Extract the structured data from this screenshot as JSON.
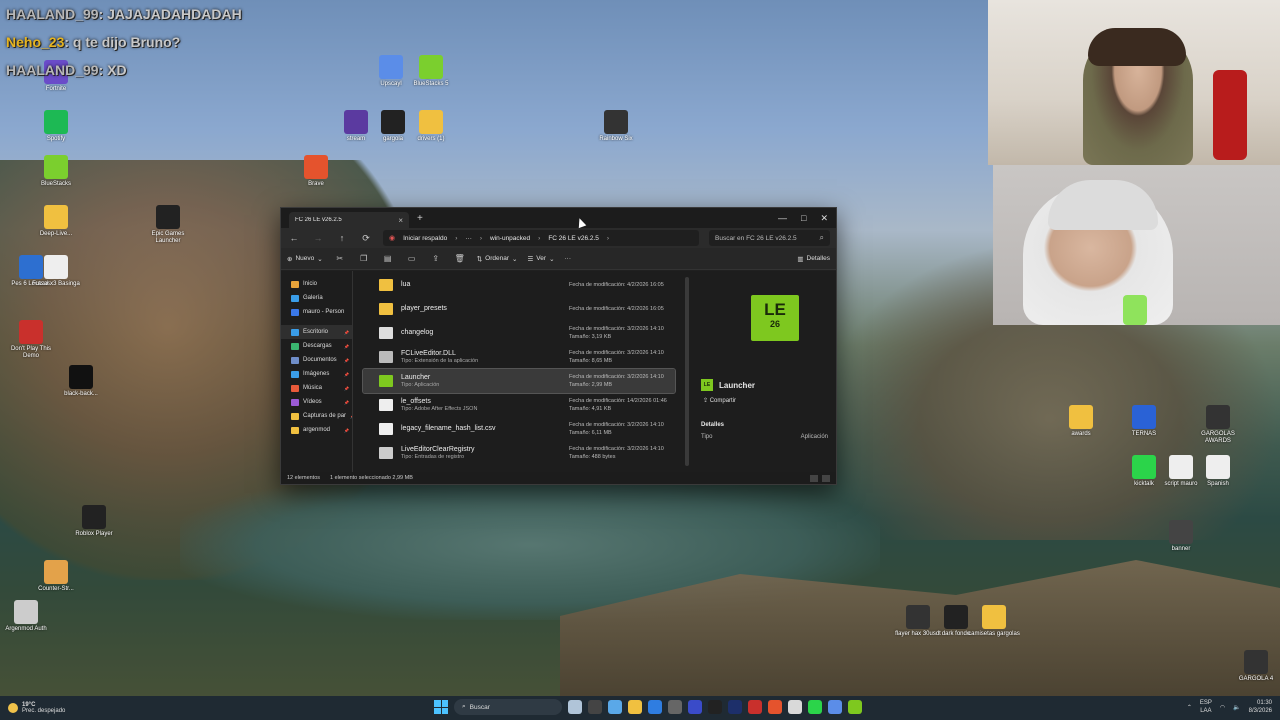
{
  "chat": [
    {
      "user": "HAALAND_99",
      "text": "JAJAJADAHDADAH"
    },
    {
      "user": "Neho_23",
      "text": "q te dijo Bruno?"
    },
    {
      "user": "HAALAND_99",
      "text": "XD"
    }
  ],
  "desktop_icons": [
    {
      "label": "Fortnite",
      "color": "#6a4cc9"
    },
    {
      "label": "Spotify",
      "color": "#1db954"
    },
    {
      "label": "BlueStacks",
      "color": "#7bcf2e"
    },
    {
      "label": "Deep-Live...",
      "color": "#f0c040"
    },
    {
      "label": "Pes 6 Locazos",
      "color": "#2d6fd0"
    },
    {
      "label": "Futsal x3 Basinga",
      "color": "#eeeeee"
    },
    {
      "label": "Don't Play This Demo",
      "color": "#c9302c"
    },
    {
      "label": "black-back...",
      "color": "#111111"
    },
    {
      "label": "Counter-Str...",
      "color": "#e3a24a"
    },
    {
      "label": "Roblox Player",
      "color": "#222222"
    },
    {
      "label": "Argenmod Auth",
      "color": "#cccccc"
    },
    {
      "label": "Epic Games Launcher",
      "color": "#222222"
    },
    {
      "label": "Upscayl",
      "color": "#5b8de8"
    },
    {
      "label": "BlueStacks 5",
      "color": "#7bcf2e"
    },
    {
      "label": "Brave",
      "color": "#e5532d"
    },
    {
      "label": "stream",
      "color": "#5b3aa0"
    },
    {
      "label": "gargola",
      "color": "#222222"
    },
    {
      "label": "drivers (1)",
      "color": "#f0c040"
    },
    {
      "label": "Rainbow Six",
      "color": "#333333"
    },
    {
      "label": "script mauro",
      "color": "#eeeeee"
    },
    {
      "label": "kicktalk",
      "color": "#2bd44a"
    },
    {
      "label": "Spanish",
      "color": "#eeeeee"
    },
    {
      "label": "awards",
      "color": "#f0c040"
    },
    {
      "label": "TERNAS",
      "color": "#2a62d6"
    },
    {
      "label": "GARGOLAS AWARDS",
      "color": "#333333"
    },
    {
      "label": "banner",
      "color": "#444444"
    },
    {
      "label": "flayer hax 30usdt",
      "color": "#333333"
    },
    {
      "label": "dark fondo",
      "color": "#222222"
    },
    {
      "label": "camisetas gargolas",
      "color": "#f0c040"
    },
    {
      "label": "GARGOLA 4",
      "color": "#333333"
    }
  ],
  "explorer": {
    "tab_title": "FC 26 LE v26.2.5",
    "breadcrumbs": [
      "Iniciar respaldo",
      "···",
      "win-unpacked",
      "FC 26 LE v26.2.5"
    ],
    "search_placeholder": "Buscar en FC 26 LE v26.2.5",
    "toolbar": {
      "new": "Nuevo",
      "sort": "Ordenar",
      "view": "Ver",
      "more": "···",
      "details": "Detalles"
    },
    "nav": {
      "top": [
        {
          "label": "Inicio",
          "color": "#e8a33a"
        },
        {
          "label": "Galería",
          "color": "#3a9de8"
        },
        {
          "label": "mauro - Person",
          "color": "#3a78e8"
        }
      ],
      "pinned": [
        {
          "label": "Escritorio",
          "color": "#3a9de8"
        },
        {
          "label": "Descargas",
          "color": "#3ab56f"
        },
        {
          "label": "Documentos",
          "color": "#6f8ec9"
        },
        {
          "label": "Imágenes",
          "color": "#3a9de8"
        },
        {
          "label": "Música",
          "color": "#e85a3a"
        },
        {
          "label": "Vídeos",
          "color": "#9b5ad6"
        },
        {
          "label": "Capturas de par",
          "color": "#f0c040"
        },
        {
          "label": "argenmod",
          "color": "#f0c040"
        }
      ]
    },
    "files": [
      {
        "name": "lua",
        "subtitle": "",
        "date": "Fecha de modificación: 4/2/2026 16:05",
        "size": "",
        "icon": "#f0c040"
      },
      {
        "name": "player_presets",
        "subtitle": "",
        "date": "Fecha de modificación: 4/2/2026 16:05",
        "size": "",
        "icon": "#f0c040"
      },
      {
        "name": "changelog",
        "subtitle": "",
        "date": "Fecha de modificación: 3/2/2026 14:10",
        "size": "Tamaño: 3,19 KB",
        "icon": "#dddddd"
      },
      {
        "name": "FCLiveEditor.DLL",
        "subtitle": "Tipo: Extensión de la aplicación",
        "date": "Fecha de modificación: 3/2/2026 14:10",
        "size": "Tamaño: 8,65 MB",
        "icon": "#bbbbbb"
      },
      {
        "name": "Launcher",
        "subtitle": "Tipo: Aplicación",
        "date": "Fecha de modificación: 3/2/2026 14:10",
        "size": "Tamaño: 2,99 MB",
        "icon": "#7ec81f"
      },
      {
        "name": "le_offsets",
        "subtitle": "Tipo: Adobe After Effects JSON",
        "date": "Fecha de modificación: 14/2/2026 01:46",
        "size": "Tamaño: 4,91 KB",
        "icon": "#eeeeee"
      },
      {
        "name": "legacy_filename_hash_list.csv",
        "subtitle": "",
        "date": "Fecha de modificación: 3/2/2026 14:10",
        "size": "Tamaño: 6,11 MB",
        "icon": "#eeeeee"
      },
      {
        "name": "LiveEditorClearRegistry",
        "subtitle": "Tipo: Entradas de registro",
        "date": "Fecha de modificación: 3/2/2026 14:10",
        "size": "Tamaño: 488 bytes",
        "icon": "#cccccc"
      }
    ],
    "details_pane": {
      "logo_top": "LE",
      "logo_bottom": "26",
      "name": "Launcher",
      "share": "Compartir",
      "section": "Detalles",
      "type_label": "Tipo",
      "type_value": "Aplicación"
    },
    "status": {
      "count": "12 elementos",
      "selected": "1 elemento seleccionado  2,99 MB"
    }
  },
  "taskbar": {
    "weather_temp": "19°C",
    "weather_desc": "Prec. despejado",
    "search": "Buscar",
    "lang_top": "ESP",
    "lang_bottom": "LAA",
    "time": "01:30",
    "date": "8/3/2026"
  }
}
